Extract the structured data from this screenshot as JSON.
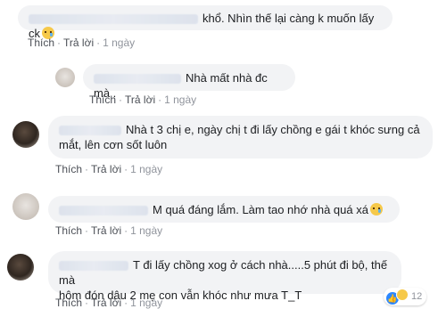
{
  "comments": [
    {
      "text": "khổ. Nhìn thế lại càng k muốn lấy ck",
      "has_emoji": true,
      "like": "Thích",
      "reply": "Trả lời",
      "time": "1 ngày"
    },
    {
      "text": "Nhà mất nhà đc mà .",
      "like": "Thích",
      "reply": "Trả lời",
      "time": "1 ngày"
    },
    {
      "line1": "Nhà t 3 chị e, ngày chị t đi lấy chồng e gái t khóc sưng cả",
      "line2": "mắt, lên cơn sốt luôn",
      "like": "Thích",
      "reply": "Trả lời",
      "time": "1 ngày"
    },
    {
      "text": "M quá đáng lắm. Làm tao nhớ nhà quá xá",
      "has_emoji": true,
      "like": "Thích",
      "reply": "Trả lời",
      "time": "1 ngày"
    },
    {
      "line1": "T đi lấy chồng xog ở cách nhà.....5 phút đi bộ, thế mà",
      "line2": "hôm đón dâu 2 mẹ con vẫn khóc như mưa T_T",
      "reaction_count": "12",
      "like": "Thích",
      "reply": "Trả lời",
      "time": "1 ngày"
    }
  ],
  "icons": {
    "emoji": "crying-face-icon",
    "like_reaction": "like-reaction-icon",
    "haha_reaction": "haha-reaction-icon"
  }
}
